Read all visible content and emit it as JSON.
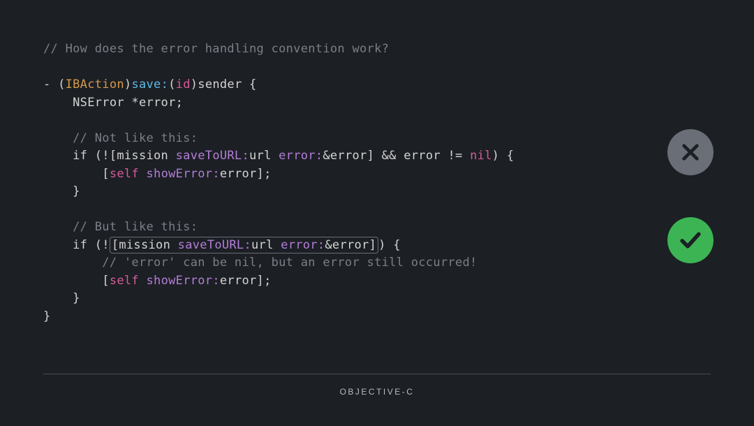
{
  "code": {
    "comment_header": "// How does the error handling convention work?",
    "line_method_decl_prefix": "- (",
    "line_method_decl_type": "IBAction",
    "line_method_decl_close": ")",
    "line_method_name": "save:",
    "line_method_paren": "(",
    "line_method_id": "id",
    "line_method_paren_close": ")",
    "line_method_sender": "sender {",
    "line_nserror": "    NSError *error;",
    "comment_not_like": "    // Not like this:",
    "line_if1_prefix": "    if (![mission ",
    "line_if1_save": "saveToURL:",
    "line_if1_url": "url ",
    "line_if1_error": "error:",
    "line_if1_amp": "&error] && error != ",
    "line_if1_nil": "nil",
    "line_if1_close": ") {",
    "line_show1_prefix": "        [",
    "line_show1_self": "self",
    "line_show1_space": " ",
    "line_show1_method": "showError:",
    "line_show1_arg": "error];",
    "line_brace1": "    }",
    "comment_but_like": "    // But like this:",
    "line_if2_prefix": "    if (!",
    "line_if2_box_prefix": "[mission ",
    "line_if2_save": "saveToURL:",
    "line_if2_url": "url ",
    "line_if2_error": "error:",
    "line_if2_amp": "&error]",
    "line_if2_close": ") {",
    "comment_error_nil": "        // 'error' can be nil, but an error still occurred!",
    "line_show2_prefix": "        [",
    "line_show2_self": "self",
    "line_show2_space": " ",
    "line_show2_method": "showError:",
    "line_show2_arg": "error];",
    "line_brace2": "    }",
    "line_brace_end": "}"
  },
  "icons": {
    "cross": "cross-icon",
    "check": "check-icon"
  },
  "footer": {
    "label": "OBJECTIVE-C"
  }
}
